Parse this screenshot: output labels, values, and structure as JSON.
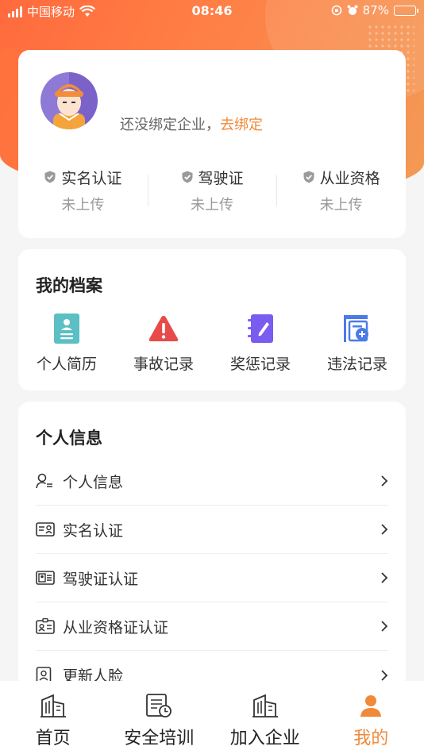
{
  "status_bar": {
    "carrier": "中国移动",
    "time": "08:46",
    "battery": "87%",
    "battery_level": 0.87
  },
  "profile": {
    "bind_text": "还没绑定企业，",
    "bind_link": "去绑定",
    "certs": [
      {
        "title": "实名认证",
        "status": "未上传"
      },
      {
        "title": "驾驶证",
        "status": "未上传"
      },
      {
        "title": "从业资格",
        "status": "未上传"
      }
    ]
  },
  "archive": {
    "title": "我的档案",
    "items": [
      {
        "label": "个人简历",
        "icon": "resume-icon",
        "color": "#5bbfc4"
      },
      {
        "label": "事故记录",
        "icon": "warning-icon",
        "color": "#e84a4a"
      },
      {
        "label": "奖惩记录",
        "icon": "notebook-icon",
        "color": "#7b5cf0"
      },
      {
        "label": "违法记录",
        "icon": "ticket-icon",
        "color": "#4a7be8"
      }
    ]
  },
  "info": {
    "title": "个人信息",
    "items": [
      {
        "label": "个人信息",
        "icon": "person-list-icon"
      },
      {
        "label": "实名认证",
        "icon": "id-card-icon"
      },
      {
        "label": "驾驶证认证",
        "icon": "license-icon"
      },
      {
        "label": "从业资格证认证",
        "icon": "badge-icon"
      },
      {
        "label": "更新人脸",
        "icon": "face-icon"
      }
    ]
  },
  "tabs": [
    {
      "label": "首页",
      "icon": "building-icon"
    },
    {
      "label": "安全培训",
      "icon": "training-icon"
    },
    {
      "label": "加入企业",
      "icon": "company-icon"
    },
    {
      "label": "我的",
      "icon": "user-icon"
    }
  ],
  "colors": {
    "accent": "#f08a3a",
    "header_gradient_start": "#ff6a3d",
    "header_gradient_end": "#f39a55"
  }
}
